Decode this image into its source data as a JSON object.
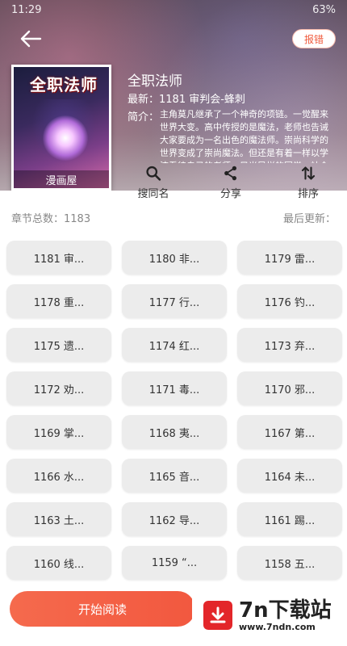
{
  "status_bar": {
    "time": "11:29",
    "battery": "63%"
  },
  "header": {
    "report_label": "报错",
    "cover_title": "全职法师",
    "cover_badge": "漫画屋",
    "book_title": "全职法师",
    "latest": "最新：1181 审判会-蜂刺",
    "intro_label": "简介：",
    "intro_text": "主角莫凡继承了一个神奇的项链。一觉醒来世界大变。高中传授的是魔法，老师也告诫大家要成为一名出色的魔法师。崇尚科学的世界变成了崇尚魔法。但还是有着一样以学渣看待自己的老师、目光异样的同学、社会最底层挣扎的父亲、寄人篱下的妹妹……"
  },
  "actions": [
    {
      "label": "搜同名",
      "icon": "search-icon"
    },
    {
      "label": "分享",
      "icon": "share-icon"
    },
    {
      "label": "排序",
      "icon": "sort-icon"
    }
  ],
  "info": {
    "total_label": "章节总数：1183",
    "updated_label": "最后更新："
  },
  "chapters": [
    "1181 审...",
    "1180 非...",
    "1179 雷...",
    "1178 重...",
    "1177 行...",
    "1176 钓...",
    "1175 遗...",
    "1174 红...",
    "1173 弃...",
    "1172 劝...",
    "1171 毒...",
    "1170 邪...",
    "1169 掌...",
    "1168 夷...",
    "1167 第...",
    "1166 水...",
    "1165 音...",
    "1164 未...",
    "1163 土...",
    "1162 导...",
    "1161 踢...",
    "1160 线...",
    "1159 “...",
    "1158 五..."
  ],
  "bottom": {
    "read_label": "开始阅读"
  },
  "watermark": {
    "title": "7n下载站",
    "url": "www.7ndn.com"
  },
  "colors": {
    "accent": "#f2583f",
    "chip_bg": "#ececec"
  }
}
